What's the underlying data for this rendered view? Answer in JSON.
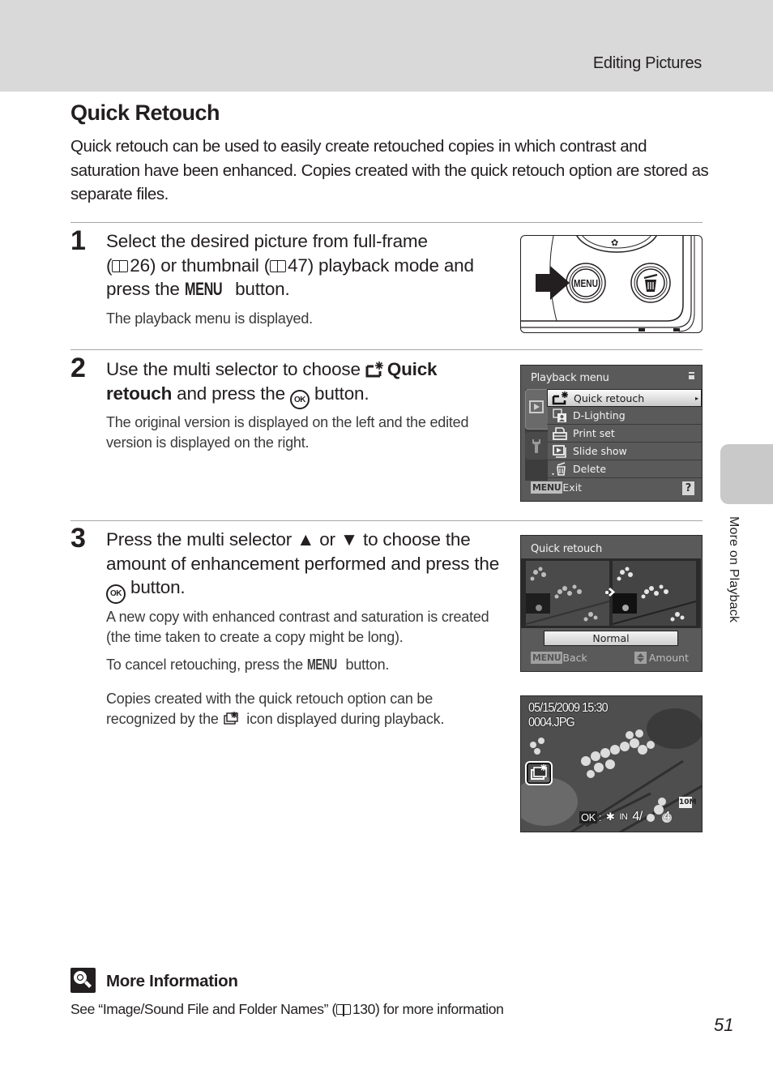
{
  "header": {
    "section_title": "Editing Pictures"
  },
  "side_tab": {
    "label": "More on Playback"
  },
  "page": {
    "title": "Quick Retouch",
    "intro": "Quick retouch can be used to easily create retouched copies in which contrast and saturation have been enhanced. Copies created with the quick retouch option are stored as separate files.",
    "page_number": "51"
  },
  "steps": [
    {
      "number": "1",
      "head_parts": {
        "a": "Select the desired picture from full-frame",
        "b": "(",
        "ref1": "26",
        "c": ") or thumbnail (",
        "ref2": "47",
        "d": ") playback mode and press the ",
        "menu": "MENU",
        "e": " button."
      },
      "body": "The playback menu is displayed.",
      "illustration": {
        "menu_button_label": "MENU",
        "icon_names": [
          "arrow-right-icon",
          "menu-button-icon",
          "trash-button-icon"
        ]
      }
    },
    {
      "number": "2",
      "head_parts": {
        "a": "Use the multi selector to choose ",
        "bold1": "Quick",
        "bold2": "retouch",
        "b": " and press the ",
        "ok": "OK",
        "c": " button."
      },
      "body": "The original version is displayed on the left and the edited version is displayed on the right.",
      "screen": {
        "title": "Playback menu",
        "items": [
          {
            "label": "Quick retouch",
            "icon": "quick-retouch-icon",
            "selected": true
          },
          {
            "label": "D-Lighting",
            "icon": "d-lighting-icon",
            "selected": false
          },
          {
            "label": "Print set",
            "icon": "print-set-icon",
            "selected": false
          },
          {
            "label": "Slide show",
            "icon": "slide-show-icon",
            "selected": false
          },
          {
            "label": "Delete",
            "icon": "delete-icon",
            "selected": false
          }
        ],
        "footer_button": "MENU",
        "footer_label": "Exit",
        "help": "?"
      }
    },
    {
      "number": "3",
      "head_parts": {
        "a": "Press the multi selector ",
        "up": "▲",
        "b": " or ",
        "down": "▼",
        "c": " to choose the amount of enhancement performed and press the ",
        "ok": "OK",
        "d": " button."
      },
      "body1": "A new copy with enhanced contrast and saturation is created (the time taken to create a copy might be long).",
      "body2_a": "To cancel retouching, press the ",
      "body2_menu": "MENU",
      "body2_b": " button.",
      "body3_a": "Copies created with the quick retouch option can be recognized by the ",
      "body3_b": " icon displayed during playback.",
      "screen": {
        "title": "Quick retouch",
        "amount_value": "Normal",
        "footer_button": "MENU",
        "footer_left": "Back",
        "footer_right": "Amount"
      },
      "playback_screen": {
        "datetime": "05/15/2009 15:30",
        "filename": "0004.JPG",
        "ok_label": "OK",
        "memory": "IN",
        "frame_current": "4/",
        "frame_total": "4",
        "image_size": "10M"
      }
    }
  ],
  "more_info": {
    "title": "More Information",
    "text_a": "See “Image/Sound File and Folder Names” (",
    "ref": "130",
    "text_b": ") for more information"
  }
}
